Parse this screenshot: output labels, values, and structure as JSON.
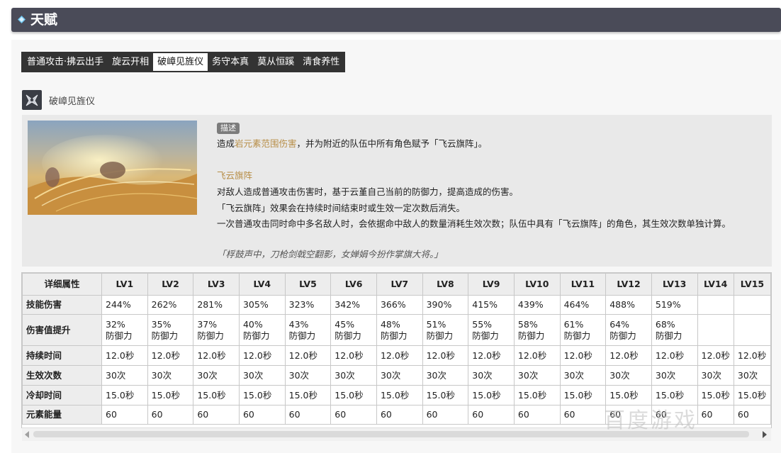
{
  "header": {
    "title": "天赋",
    "icon": "diamond-icon",
    "accent": "#4a4b58"
  },
  "tabs": [
    {
      "label": "普通攻击·拂云出手",
      "active": false
    },
    {
      "label": "旋云开相",
      "active": false
    },
    {
      "label": "破嶂见旌仪",
      "active": true
    },
    {
      "label": "务守本真",
      "active": false
    },
    {
      "label": "莫从恒蹊",
      "active": false
    },
    {
      "label": "清食养性",
      "active": false
    }
  ],
  "skill": {
    "name": "破嶂见旌仪",
    "icon": "skill-emblem-icon",
    "desc_tag": "描述",
    "line1_pre": "造成",
    "line1_hl": "岩元素范围伤害",
    "line1_post": "，并为附近的队伍中所有角色赋予「飞云旗阵」。",
    "subtitle": "飞云旗阵",
    "line3": "对敌人造成普通攻击伤害时，基于云堇自己当前的防御力，提高造成的伤害。",
    "line4": "「飞云旗阵」效果会在持续时间结束时或生效一定次数后消失。",
    "line5": "一次普通攻击同时命中多名敌人时，会依据命中敌人的数量消耗生效次数；队伍中具有「飞云旗阵」的角色，其生效次数单独计算。",
    "quote": "「桴鼓声中，刀枪剑戟空翻影，女婵娟今扮作掌旗大将。」",
    "highlight_color": "#b78d46"
  },
  "table": {
    "header_label": "详细属性",
    "levels": [
      "LV1",
      "LV2",
      "LV3",
      "LV4",
      "LV5",
      "LV6",
      "LV7",
      "LV8",
      "LV9",
      "LV10",
      "LV11",
      "LV12",
      "LV13",
      "LV14",
      "LV15"
    ],
    "rows": [
      {
        "label": "技能伤害",
        "values": [
          "244%",
          "262%",
          "281%",
          "305%",
          "323%",
          "342%",
          "366%",
          "390%",
          "415%",
          "439%",
          "464%",
          "488%",
          "519%",
          "",
          ""
        ]
      },
      {
        "label": "伤害值提升",
        "values": [
          [
            "32%",
            "防御力"
          ],
          [
            "35%",
            "防御力"
          ],
          [
            "37%",
            "防御力"
          ],
          [
            "40%",
            "防御力"
          ],
          [
            "43%",
            "防御力"
          ],
          [
            "45%",
            "防御力"
          ],
          [
            "48%",
            "防御力"
          ],
          [
            "51%",
            "防御力"
          ],
          [
            "55%",
            "防御力"
          ],
          [
            "58%",
            "防御力"
          ],
          [
            "61%",
            "防御力"
          ],
          [
            "64%",
            "防御力"
          ],
          [
            "68%",
            "防御力"
          ],
          [
            "",
            ""
          ],
          [
            "",
            ""
          ]
        ]
      },
      {
        "label": "持续时间",
        "values": [
          "12.0秒",
          "12.0秒",
          "12.0秒",
          "12.0秒",
          "12.0秒",
          "12.0秒",
          "12.0秒",
          "12.0秒",
          "12.0秒",
          "12.0秒",
          "12.0秒",
          "12.0秒",
          "12.0秒",
          "12.0秒",
          "12.0秒"
        ]
      },
      {
        "label": "生效次数",
        "values": [
          "30次",
          "30次",
          "30次",
          "30次",
          "30次",
          "30次",
          "30次",
          "30次",
          "30次",
          "30次",
          "30次",
          "30次",
          "30次",
          "30次",
          "30次"
        ]
      },
      {
        "label": "冷却时间",
        "values": [
          "15.0秒",
          "15.0秒",
          "15.0秒",
          "15.0秒",
          "15.0秒",
          "15.0秒",
          "15.0秒",
          "15.0秒",
          "15.0秒",
          "15.0秒",
          "15.0秒",
          "15.0秒",
          "15.0秒",
          "15.0秒",
          "15.0秒"
        ]
      },
      {
        "label": "元素能量",
        "values": [
          "60",
          "60",
          "60",
          "60",
          "60",
          "60",
          "60",
          "60",
          "60",
          "60",
          "60",
          "60",
          "60",
          "60",
          "60"
        ]
      }
    ]
  },
  "watermark": "百度游戏"
}
